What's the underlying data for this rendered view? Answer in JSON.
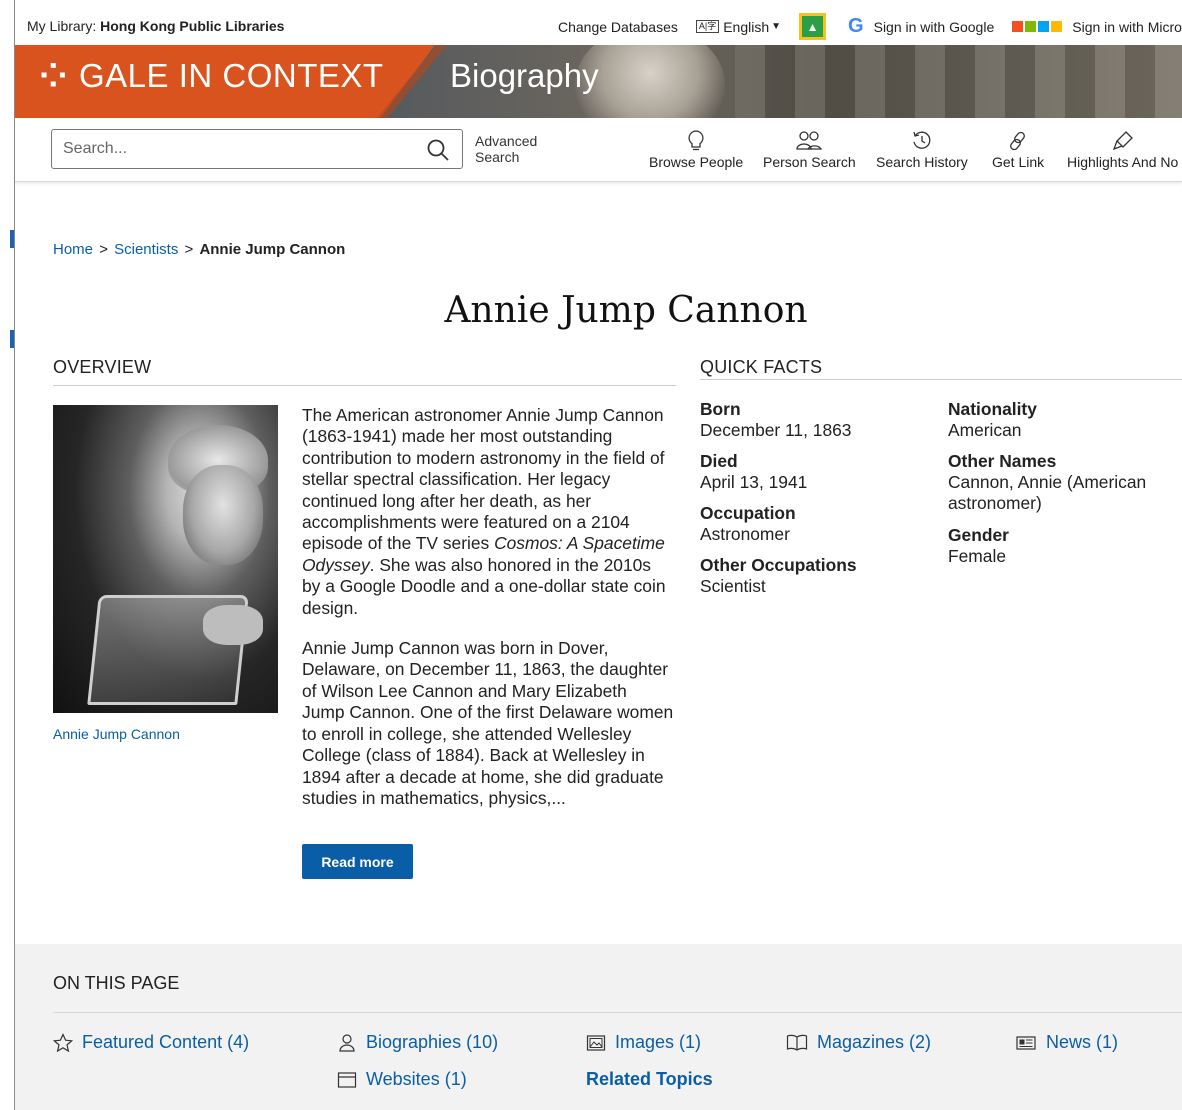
{
  "top_bar": {
    "library_prefix": "My Library:",
    "library_name": "Hong Kong Public Libraries",
    "change_databases": "Change Databases",
    "language": "English",
    "google_signin": "Sign in with Google",
    "microsoft_signin": "Sign in with Micros"
  },
  "banner": {
    "brand": "GALE IN CONTEXT",
    "product": "Biography",
    "brand_color": "#d9531e"
  },
  "search": {
    "placeholder": "Search...",
    "advanced_line1": "Advanced",
    "advanced_line2": "Search"
  },
  "nav": [
    {
      "label": "Browse People",
      "icon": "lightbulb-icon"
    },
    {
      "label": "Person Search",
      "icon": "people-icon"
    },
    {
      "label": "Search History",
      "icon": "history-icon"
    },
    {
      "label": "Get Link",
      "icon": "link-icon"
    },
    {
      "label": "Highlights And No",
      "icon": "highlighter-icon"
    }
  ],
  "breadcrumb": {
    "home": "Home",
    "sep": ">",
    "scientists": "Scientists",
    "current": "Annie Jump Cannon"
  },
  "page_title": "Annie Jump Cannon",
  "overview": {
    "heading": "OVERVIEW",
    "caption": "Annie Jump Cannon",
    "p1_a": "The American astronomer Annie Jump Cannon (1863-1941) made her most outstanding contribution to modern astronomy in the field of stellar spectral classification. Her legacy continued long after her death, as her accomplishments were featured on a 2104 episode of the TV series ",
    "p1_em": "Cosmos: A Spacetime Odyssey",
    "p1_b": ". She was also honored in the 2010s by a Google Doodle and a one-dollar state coin design.",
    "p2": "Annie Jump Cannon was born in Dover, Delaware, on December 11, 1863, the daughter of Wilson Lee Cannon and Mary Elizabeth Jump Cannon. One of the first Delaware women to enroll in college, she attended Wellesley College (class of 1884). Back at Wellesley in 1894 after a decade at home, she did graduate studies in mathematics, physics,...",
    "read_more": "Read more"
  },
  "quick_facts": {
    "heading": "QUICK FACTS",
    "born_label": "Born",
    "born": "December 11, 1863",
    "died_label": "Died",
    "died": "April 13, 1941",
    "occupation_label": "Occupation",
    "occupation": "Astronomer",
    "other_occupations_label": "Other Occupations",
    "other_occupations": "Scientist",
    "nationality_label": "Nationality",
    "nationality": "American",
    "other_names_label": "Other Names",
    "other_names": "Cannon, Annie (American astronomer)",
    "gender_label": "Gender",
    "gender": "Female"
  },
  "on_this_page": {
    "heading": "ON THIS PAGE",
    "featured": "Featured Content (4)",
    "biographies": "Biographies (10)",
    "images": "Images (1)",
    "magazines": "Magazines (2)",
    "news": "News (1)",
    "websites": "Websites (1)",
    "related": "Related Topics"
  },
  "colors": {
    "link": "#0a5ea8",
    "button": "#0a5ea8"
  }
}
